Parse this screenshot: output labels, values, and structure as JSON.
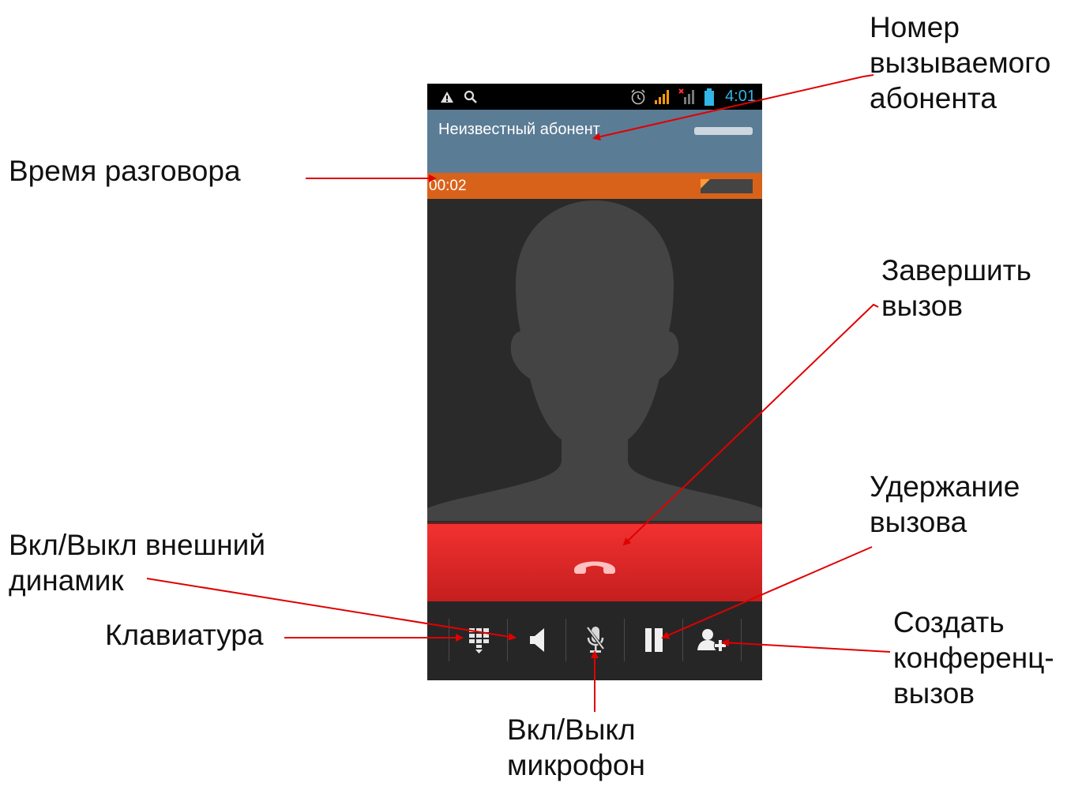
{
  "status_bar": {
    "icons_left": [
      "warning-icon",
      "search-icon"
    ],
    "icons_right": [
      "alarm-icon",
      "signal-icon",
      "signal-no-sim-icon",
      "battery-icon"
    ],
    "time": "4:01"
  },
  "call": {
    "caller_name": "Неизвестный абонент",
    "duration": "00:02",
    "end_call_icon": "phone-hangup-icon"
  },
  "controls": [
    {
      "id": "keypad",
      "icon": "dialpad-icon"
    },
    {
      "id": "speaker",
      "icon": "speaker-icon"
    },
    {
      "id": "mute",
      "icon": "microphone-mute-icon"
    },
    {
      "id": "hold",
      "icon": "hold-icon"
    },
    {
      "id": "add-call",
      "icon": "add-call-icon"
    }
  ],
  "annotations": {
    "caller_number": "Номер\nвызываемого\nабонента",
    "call_time": "Время разговора",
    "end_call": "Завершить\nвызов",
    "hold": "Удержание\nвызова",
    "speaker": "Вкл/Выкл внешний\nдинамик",
    "keypad": "Клавиатура",
    "conference": "Создать\nконференц-\nвызов",
    "microphone": "Вкл/Выкл\nмикрофон"
  },
  "colors": {
    "header": "#5b7c95",
    "timer_bar": "#d9621b",
    "end_call": "#e52a2a",
    "arrow": "#e00000",
    "clock": "#33b5e5"
  }
}
